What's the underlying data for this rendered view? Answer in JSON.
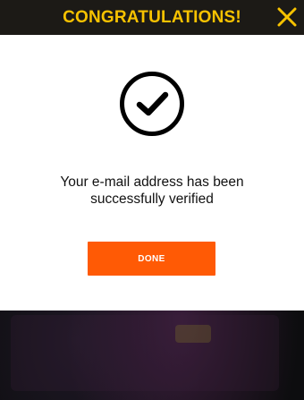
{
  "header": {
    "title": "CONGRATULATIONS!",
    "close_icon": "close-icon"
  },
  "dialog": {
    "icon": "check-circle-icon",
    "message_line1": "Your e-mail address has been",
    "message_line2": "successfully verified",
    "done_label": "DONE"
  },
  "colors": {
    "header_bg": "#1c1a16",
    "accent_yellow": "#f7c200",
    "button_orange": "#ff5a05",
    "panel_bg": "#ffffff"
  }
}
